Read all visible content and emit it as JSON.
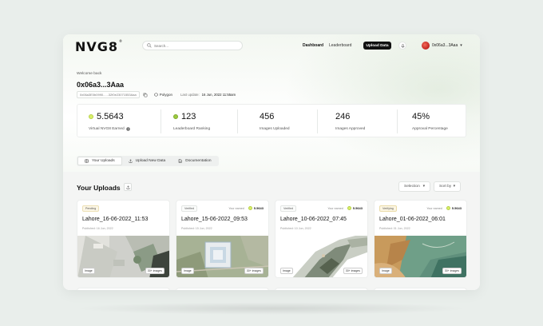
{
  "brand": {
    "logo": "NVG8",
    "logo_mark": "®"
  },
  "search": {
    "placeholder": "Search..."
  },
  "nav": {
    "dashboard": "Dashboard",
    "leaderboard": "Leaderboard",
    "upload_button": "Upload Data"
  },
  "account": {
    "name": "0x06a3...3Aaa"
  },
  "welcome": {
    "greeting": "Welcome back",
    "wallet": "0x06a3...3Aaa",
    "full_address": "0x06a3E0b0990......32f0e23071553Aaa",
    "network": "Polygon",
    "last_update_label": "Last update:",
    "last_update_value": "16 Jun, 2022  11:55am"
  },
  "stats": [
    {
      "value": "5.5643",
      "label": "Virtual NVG8 Earned"
    },
    {
      "value": "123",
      "label": "Leaderboard Ranking"
    },
    {
      "value": "456",
      "label": "Images Uploaded"
    },
    {
      "value": "246",
      "label": "Images Approved"
    },
    {
      "value": "45%",
      "label": "Approval Percentage"
    }
  ],
  "tabs": [
    {
      "label": "Your Uploads",
      "active": true,
      "icon": "grid-icon"
    },
    {
      "label": "Upload New Data",
      "active": false,
      "icon": "upload-icon"
    },
    {
      "label": "Documentation",
      "active": false,
      "icon": "document-icon"
    }
  ],
  "uploads": {
    "title": "Your Uploads",
    "selection_label": "Selection",
    "sort_label": "Sort by",
    "cards": [
      {
        "status": "Pending",
        "earned_label": "",
        "earned_value": "",
        "title": "Lahore_16-06-2022_11:53",
        "published": "Published: 16 Jun, 2022",
        "tag_left": "Image",
        "tag_right": "30+ images"
      },
      {
        "status": "Verified",
        "earned_label": "Your earned",
        "earned_value": "5.5643",
        "title": "Lahore_15-06-2022_09:53",
        "published": "Published: 15 Jun, 2022",
        "tag_left": "Image",
        "tag_right": "30+ images"
      },
      {
        "status": "Verified",
        "earned_label": "Your earned",
        "earned_value": "5.5643",
        "title": "Lahore_10-06-2022_07:45",
        "published": "Published: 10 Jun, 2022",
        "tag_left": "Image",
        "tag_right": "30+ images"
      },
      {
        "status": "Verifying",
        "earned_label": "Your earned",
        "earned_value": "5.5643",
        "title": "Lahore_01-06-2022_06:01",
        "published": "Published: 01 Jun, 2022",
        "tag_left": "Image",
        "tag_right": "30+ images"
      }
    ]
  },
  "colors": {
    "accent_coin": "#d9f06a",
    "dark_button": "#111111",
    "avatar": "#c0221e"
  }
}
